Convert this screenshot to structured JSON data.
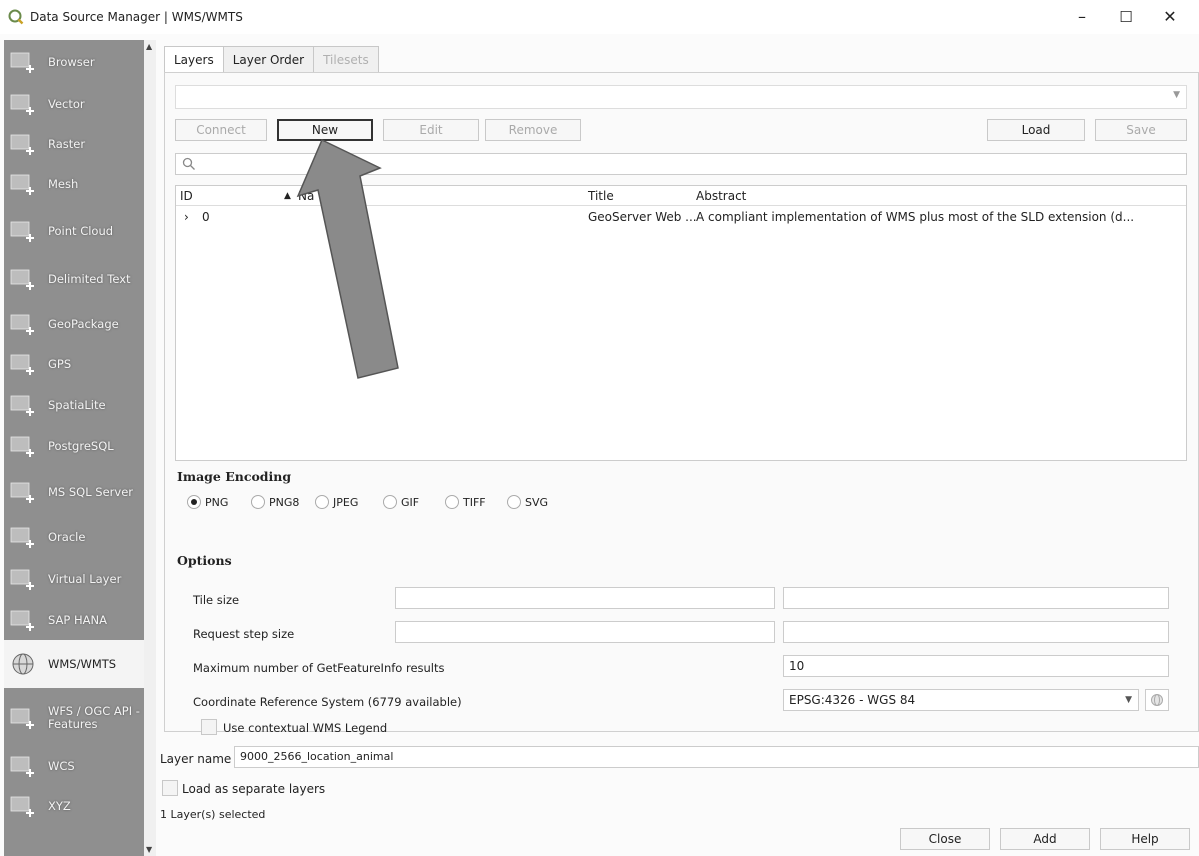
{
  "window": {
    "title": "Data Source Manager | WMS/WMTS",
    "minimize": "–",
    "maximize": "☐",
    "close": "✕"
  },
  "sidebar": {
    "items": [
      {
        "label": "Browser",
        "icon": "browser-icon"
      },
      {
        "label": "Vector",
        "icon": "vector-icon"
      },
      {
        "label": "Raster",
        "icon": "raster-icon"
      },
      {
        "label": "Mesh",
        "icon": "mesh-icon"
      },
      {
        "label": "Point Cloud",
        "icon": "point-cloud-icon"
      },
      {
        "label": "Delimited Text",
        "icon": "delimited-text-icon"
      },
      {
        "label": "GeoPackage",
        "icon": "geopackage-icon"
      },
      {
        "label": "GPS",
        "icon": "gps-icon"
      },
      {
        "label": "SpatiaLite",
        "icon": "spatialite-icon"
      },
      {
        "label": "PostgreSQL",
        "icon": "postgresql-icon"
      },
      {
        "label": "MS SQL Server",
        "icon": "mssql-icon"
      },
      {
        "label": "Oracle",
        "icon": "oracle-icon"
      },
      {
        "label": "Virtual Layer",
        "icon": "virtual-layer-icon"
      },
      {
        "label": "SAP HANA",
        "icon": "sap-hana-icon"
      },
      {
        "label": "WMS/WMTS",
        "icon": "wms-globe-icon",
        "active": true
      },
      {
        "label": "WFS / OGC API - Features",
        "icon": "wfs-icon"
      },
      {
        "label": "WCS",
        "icon": "wcs-icon"
      },
      {
        "label": "XYZ",
        "icon": "xyz-icon"
      }
    ]
  },
  "tabs": [
    {
      "label": "Layers",
      "state": "selected"
    },
    {
      "label": "Layer Order",
      "state": "normal"
    },
    {
      "label": "Tilesets",
      "state": "disabled"
    }
  ],
  "connection": {
    "value": ""
  },
  "buttons": {
    "connect": "Connect",
    "new": "New",
    "edit": "Edit",
    "remove": "Remove",
    "load": "Load",
    "save": "Save"
  },
  "search": {
    "placeholder": ""
  },
  "table": {
    "headers": {
      "id": "ID",
      "name": "Na",
      "title": "Title",
      "abstract": "Abstract"
    },
    "rows": [
      {
        "expander": "›",
        "id": "0",
        "name": "",
        "title": "GeoServer Web ...",
        "abstract": "A compliant implementation of WMS plus most of the SLD extension (d..."
      }
    ]
  },
  "image_encoding": {
    "title": "Image Encoding",
    "options": [
      "PNG",
      "PNG8",
      "JPEG",
      "GIF",
      "TIFF",
      "SVG"
    ],
    "selected": "PNG"
  },
  "options": {
    "title": "Options",
    "tile_size_label": "Tile size",
    "request_step_label": "Request step size",
    "max_getfeatureinfo_label": "Maximum number of GetFeatureInfo results",
    "max_getfeatureinfo_value": "10",
    "crs_label": "Coordinate Reference System (6779 available)",
    "crs_value": "EPSG:4326 - WGS 84",
    "contextual_legend_label": "Use contextual WMS Legend"
  },
  "layer_name": {
    "label": "Layer name",
    "value": "9000_2566_location_animal"
  },
  "load_separate_label": "Load as separate layers",
  "status": "1 Layer(s) selected",
  "footer": {
    "close": "Close",
    "add": "Add",
    "help": "Help"
  },
  "annotation": {
    "arrow_color": "#8a8a8a",
    "arrow_target": "new-button"
  }
}
